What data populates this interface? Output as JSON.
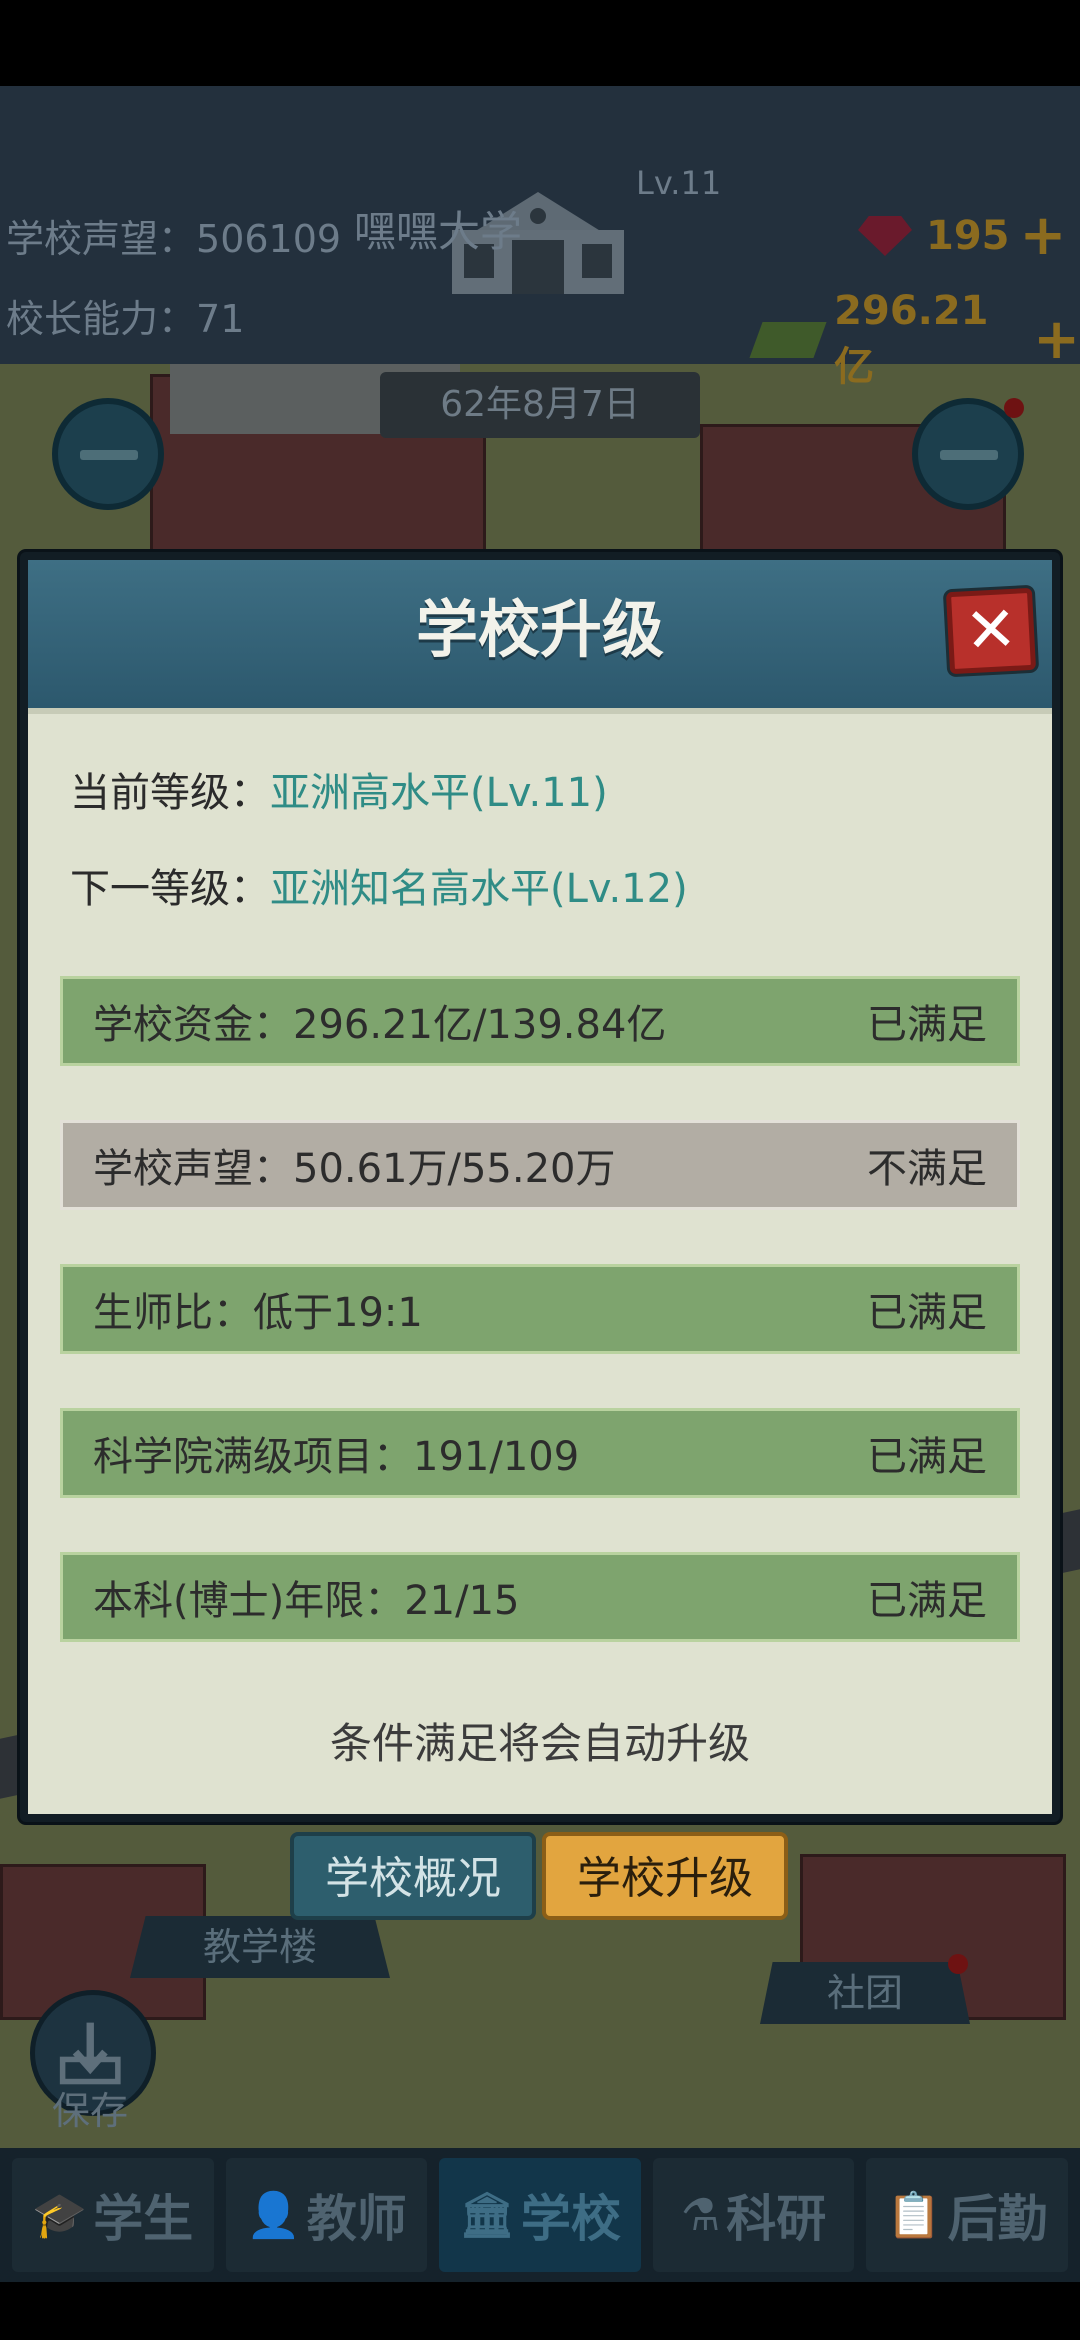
{
  "hud": {
    "reputation_label": "学校声望：",
    "reputation_value": "506109",
    "principal_label": "校长能力：",
    "principal_value": "71",
    "school_level": "Lv.11",
    "school_name": "嘿嘿大学",
    "gems": "195",
    "money": "296.21亿"
  },
  "date": "62年8月7日",
  "map_labels": {
    "teaching_building": "教学楼",
    "club": "社团",
    "save": "保存"
  },
  "modal": {
    "title": "学校升级",
    "close_icon": "close-icon",
    "current_level_label": "当前等级：",
    "current_level_value": "亚洲高水平(Lv.11)",
    "next_level_label": "下一等级：",
    "next_level_value": "亚洲知名高水平(Lv.12)",
    "conditions": [
      {
        "label": "学校资金：296.21亿/139.84亿",
        "status": "已满足",
        "met": true
      },
      {
        "label": "学校声望：50.61万/55.20万",
        "status": "不满足",
        "met": false
      },
      {
        "label": "生师比：低于19:1",
        "status": "已满足",
        "met": true
      },
      {
        "label": "科学院满级项目：191/109",
        "status": "已满足",
        "met": true
      },
      {
        "label": "本科(博士)年限：21/15",
        "status": "已满足",
        "met": true
      }
    ],
    "note": "条件满足将会自动升级"
  },
  "tabs": {
    "overview": "学校概况",
    "upgrade": "学校升级"
  },
  "bottom_nav": [
    {
      "label": "学生",
      "icon": "student-icon"
    },
    {
      "label": "教师",
      "icon": "teacher-icon"
    },
    {
      "label": "学校",
      "icon": "school-icon"
    },
    {
      "label": "科研",
      "icon": "flask-icon"
    },
    {
      "label": "后勤",
      "icon": "clipboard-icon"
    }
  ],
  "colors": {
    "met": "#7ea46e",
    "unmet": "#b2ada4",
    "accent_teal": "#2f8c86",
    "close_red": "#b8302b",
    "tab_active": "#e2a53f"
  }
}
